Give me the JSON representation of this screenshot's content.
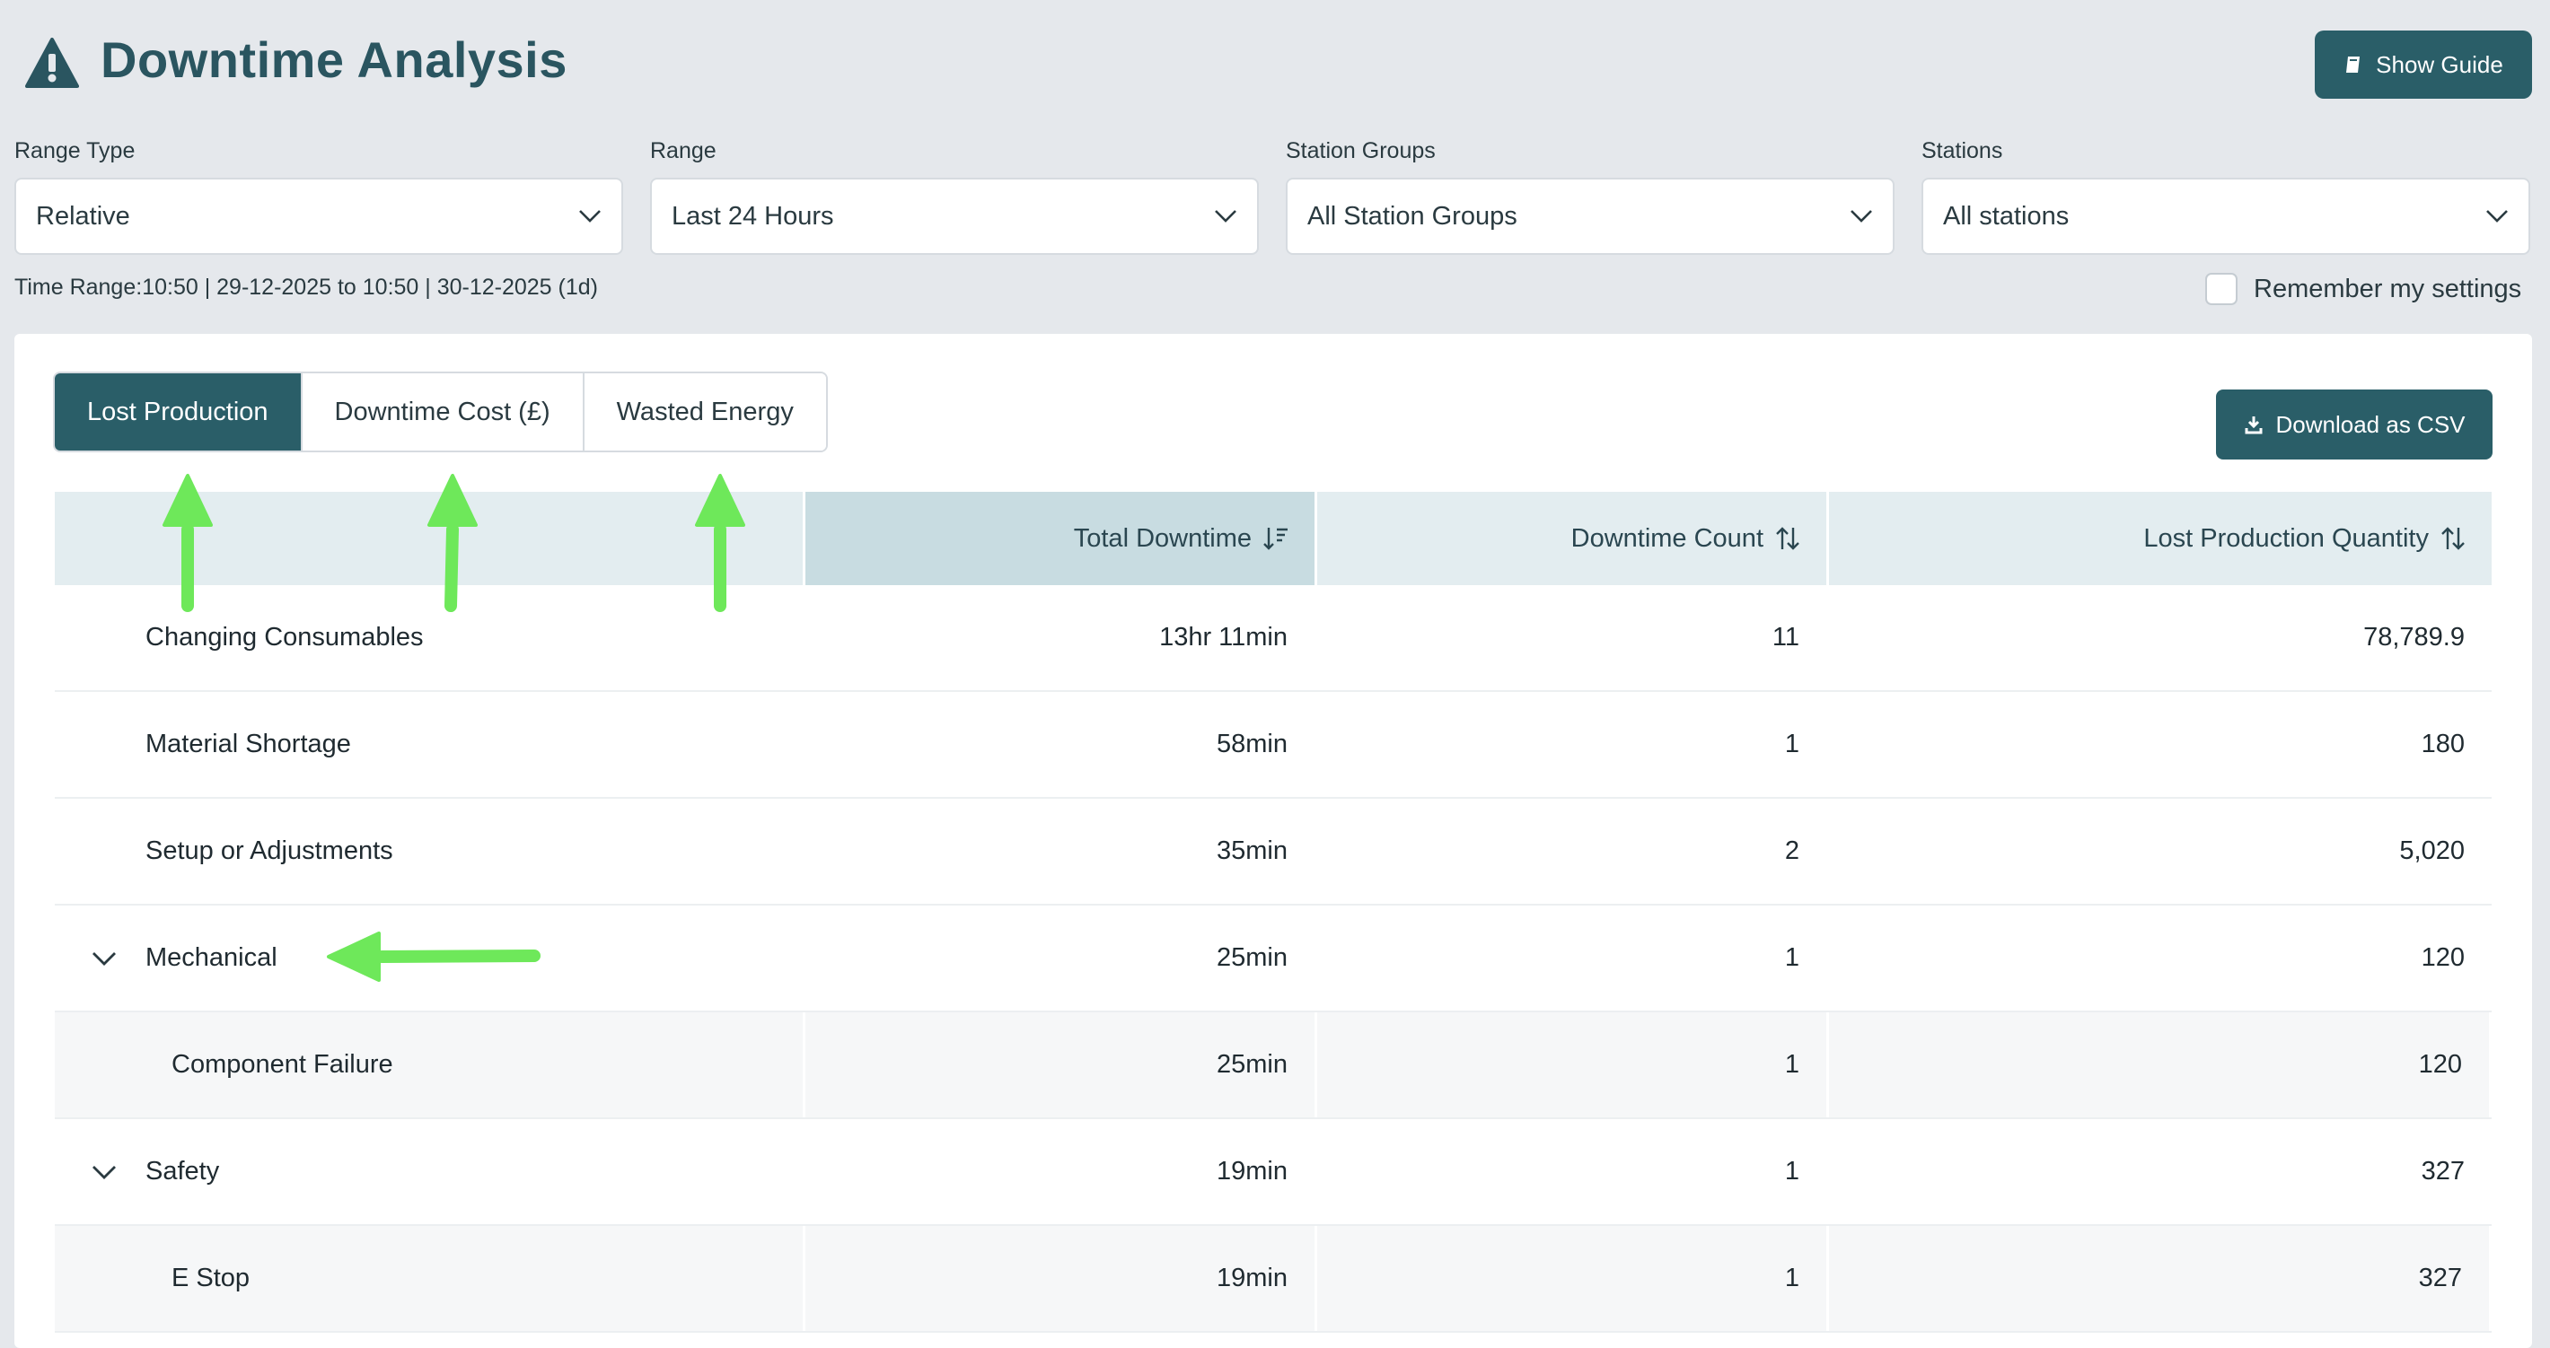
{
  "header": {
    "title": "Downtime Analysis",
    "title_icon": "warning-triangle-icon",
    "guide_label": "Show Guide",
    "guide_icon": "book-icon"
  },
  "filters": [
    {
      "label": "Range Type",
      "value": "Relative"
    },
    {
      "label": "Range",
      "value": "Last 24 Hours"
    },
    {
      "label": "Station Groups",
      "value": "All Station Groups"
    },
    {
      "label": "Stations",
      "value": "All stations"
    }
  ],
  "time_range": "Time Range:10:50 | 29-12-2025 to 10:50 | 30-12-2025 (1d)",
  "remember_label": "Remember my settings",
  "remember_checked": false,
  "tabs": [
    {
      "label": "Lost Production",
      "active": true
    },
    {
      "label": "Downtime Cost (£)",
      "active": false
    },
    {
      "label": "Wasted Energy",
      "active": false
    }
  ],
  "csv_label": "Download as CSV",
  "csv_icon": "download-icon",
  "table": {
    "columns": [
      "",
      "Total Downtime",
      "Downtime Count",
      "Lost Production Quantity"
    ],
    "sorted_column": "Total Downtime",
    "rows": [
      {
        "name": "Changing Consumables",
        "total": "13hr 11min",
        "count": "11",
        "qty": "78,789.9"
      },
      {
        "name": "Material Shortage",
        "total": "58min",
        "count": "1",
        "qty": "180"
      },
      {
        "name": "Setup or Adjustments",
        "total": "35min",
        "count": "2",
        "qty": "5,020"
      },
      {
        "name": "Mechanical",
        "total": "25min",
        "count": "1",
        "qty": "120"
      },
      {
        "name": "Component Failure",
        "total": "25min",
        "count": "1",
        "qty": "120"
      },
      {
        "name": "Safety",
        "total": "19min",
        "count": "1",
        "qty": "327"
      },
      {
        "name": "E Stop",
        "total": "19min",
        "count": "1",
        "qty": "327"
      }
    ]
  },
  "colors": {
    "primary": "#2a5e68",
    "page_bg": "#e5e8ec",
    "header_row": "#e3edf0",
    "sorted_header": "#c8dce1",
    "annotation_arrow": "#6ee85a"
  }
}
